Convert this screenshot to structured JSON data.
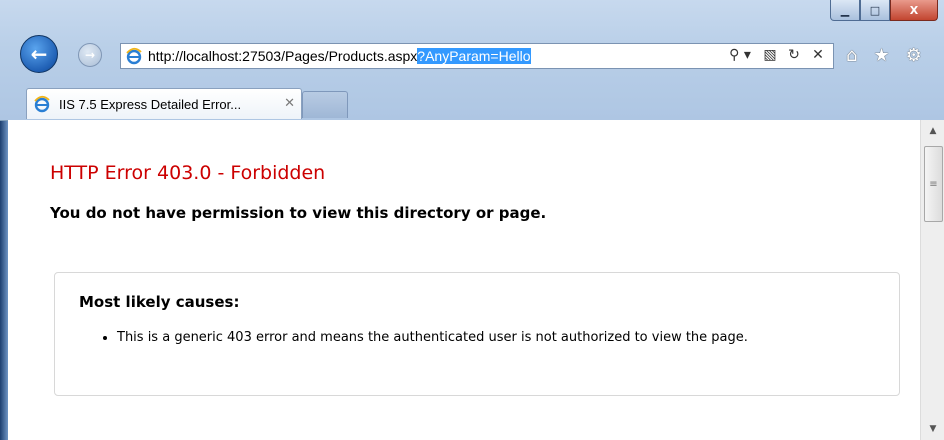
{
  "window": {
    "minimize_glyph": "▁",
    "maximize_glyph": "□",
    "close_glyph": "X"
  },
  "nav": {
    "back_glyph": "←",
    "forward_glyph": "→",
    "url_plain": "http://localhost:27503/Pages/Products.aspx",
    "url_selected": "?AnyParam=Hello",
    "search_glyph": "⚲ ▾",
    "compat_glyph": "▧",
    "refresh_glyph": "↻",
    "stop_glyph": "✕",
    "home_glyph": "⌂",
    "favorites_glyph": "★",
    "tools_glyph": "⚙"
  },
  "tab": {
    "title": "IIS 7.5 Express Detailed Error...",
    "close_glyph": "✕"
  },
  "page": {
    "error_title": "HTTP Error 403.0 - Forbidden",
    "error_subtitle": "You do not have permission to view this directory or page.",
    "causes_heading": "Most likely causes:",
    "causes": [
      "This is a generic 403 error and means the authenticated user is not authorized to view the page."
    ]
  },
  "scrollbar": {
    "up_glyph": "▲",
    "down_glyph": "▼",
    "thumb_glyph": "≡"
  },
  "colors": {
    "error_red": "#cc0000",
    "selection_blue": "#3399ff"
  }
}
